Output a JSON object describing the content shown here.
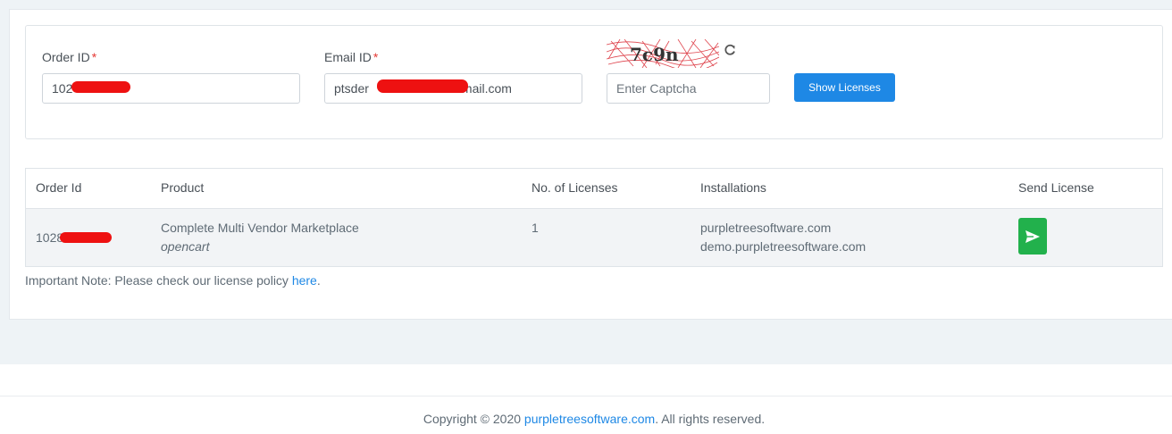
{
  "form": {
    "order_id_label": "Order ID",
    "order_id_value": "102",
    "email_label": "Email ID",
    "email_value_start": "ptsder",
    "email_value_end": "mail.com",
    "required_mark": "*",
    "captcha_text": "7c9n",
    "captcha_placeholder": "Enter Captcha",
    "show_button_label": "Show Licenses"
  },
  "table": {
    "headers": [
      "Order Id",
      "Product",
      "No. of Licenses",
      "Installations",
      "Send License"
    ],
    "rows": [
      {
        "order_id": "1028",
        "product": "Complete Multi Vendor Marketplace",
        "platform": "opencart",
        "licenses": "1",
        "installations": [
          "purpletreesoftware.com",
          "demo.purpletreesoftware.com"
        ]
      }
    ]
  },
  "note": {
    "text": "Important Note: Please check our license policy ",
    "link": "here",
    "suffix": "."
  },
  "footer": {
    "prefix": "Copyright © 2020 ",
    "link": "purpletreesoftware.com",
    "suffix": ". All rights reserved."
  },
  "colors": {
    "primary": "#1e88e5",
    "success": "#22b14c",
    "required": "#e53935"
  }
}
